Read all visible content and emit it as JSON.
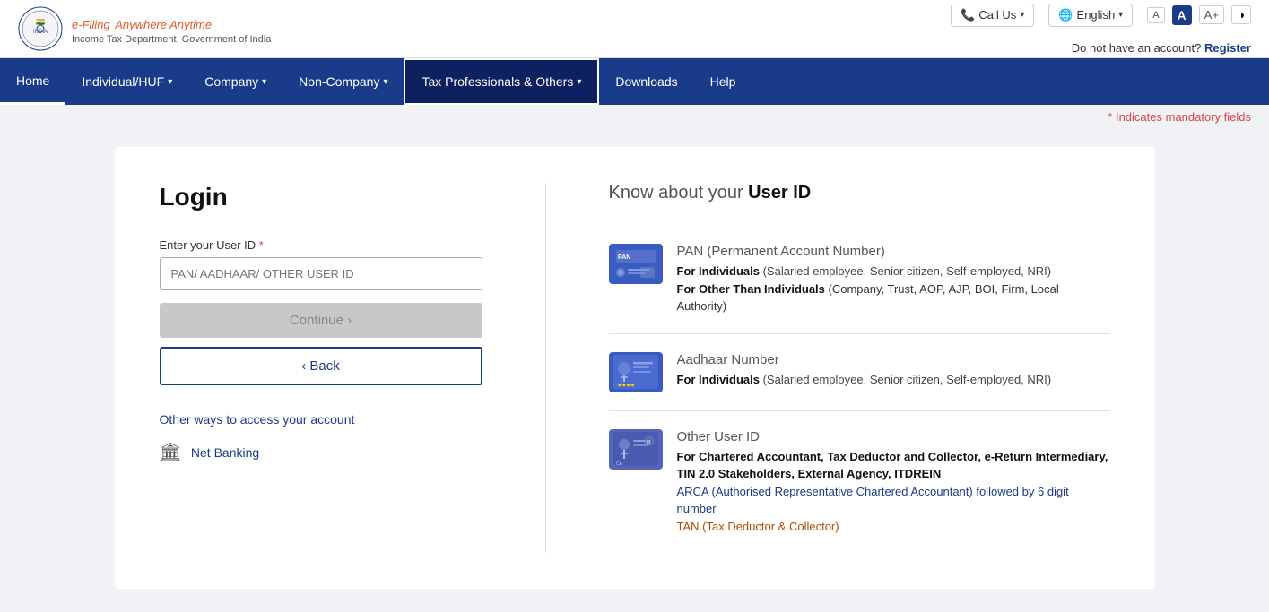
{
  "header": {
    "logo_efiling": "e-Filing",
    "logo_tagline": "Anywhere Anytime",
    "logo_dept": "Income Tax Department, Government of India",
    "call_us": "Call Us",
    "language": "English",
    "font_small": "A",
    "font_medium": "A",
    "font_large": "A+",
    "contrast": "◑",
    "no_account_text": "Do not have an account?",
    "register_text": "Register"
  },
  "nav": {
    "items": [
      {
        "label": "Home",
        "active": true,
        "has_dropdown": false
      },
      {
        "label": "Individual/HUF",
        "has_dropdown": true
      },
      {
        "label": "Company",
        "has_dropdown": true
      },
      {
        "label": "Non-Company",
        "has_dropdown": true
      },
      {
        "label": "Tax Professionals & Others",
        "has_dropdown": true,
        "highlighted": true
      },
      {
        "label": "Downloads",
        "has_dropdown": false
      },
      {
        "label": "Help",
        "has_dropdown": false
      }
    ]
  },
  "mandatory_note": "* Indicates mandatory fields",
  "login": {
    "title": "Login",
    "user_id_label": "Enter your User ID",
    "user_id_placeholder": "PAN/ AADHAAR/ OTHER USER ID",
    "continue_label": "Continue  ›",
    "back_label": "‹ Back",
    "other_ways_label": "Other ways to access your account",
    "net_banking_label": "Net Banking"
  },
  "know_section": {
    "title_prefix": "Know about your",
    "title_highlight": "User ID",
    "items": [
      {
        "type": "PAN",
        "type_desc": "(Permanent Account Number)",
        "for_individuals_label": "For Individuals",
        "for_individuals_desc": "(Salaried employee, Senior citizen, Self-employed, NRI)",
        "for_others_label": "For Other Than Individuals",
        "for_others_desc": "(Company, Trust, AOP, AJP, BOI, Firm, Local Authority)"
      },
      {
        "type": "Aadhaar Number",
        "type_desc": "",
        "for_individuals_label": "For Individuals",
        "for_individuals_desc": "(Salaried employee, Senior citizen, Self-employed, NRI)"
      },
      {
        "type": "Other User ID",
        "type_desc": "",
        "for_label": "For Chartered Accountant, Tax Deductor and Collector, e-Return Intermediary, TIN 2.0 Stakeholders, External Agency, ITDREIN",
        "arca_desc": "ARCA (Authorised Representative Chartered Accountant) followed by 6 digit number",
        "tan_desc": "TAN (Tax Deductor & Collector)"
      }
    ]
  }
}
